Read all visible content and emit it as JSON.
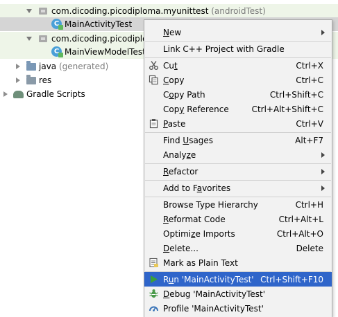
{
  "tree": {
    "rows": [
      {
        "label": "com.dicoding.picodiploma.myunittest",
        "suffix": "(androidTest)"
      },
      {
        "label": "MainActivityTest"
      },
      {
        "label": "com.dicoding.picodiplom"
      },
      {
        "label": "MainViewModelTest"
      },
      {
        "label": "java",
        "suffix": "(generated)"
      },
      {
        "label": "res"
      },
      {
        "label": "Gradle Scripts"
      }
    ]
  },
  "menu": {
    "items": [
      {
        "pre": "",
        "mn": "N",
        "post": "ew",
        "shortcut": ""
      },
      {
        "pre": "Link C++ Project with Gradle",
        "mn": "",
        "post": "",
        "shortcut": ""
      },
      {
        "pre": "Cu",
        "mn": "t",
        "post": "",
        "shortcut": "Ctrl+X"
      },
      {
        "pre": "",
        "mn": "C",
        "post": "opy",
        "shortcut": "Ctrl+C"
      },
      {
        "pre": "C",
        "mn": "o",
        "post": "py Path",
        "shortcut": "Ctrl+Shift+C"
      },
      {
        "pre": "Cop",
        "mn": "y",
        "post": " Reference",
        "shortcut": "Ctrl+Alt+Shift+C"
      },
      {
        "pre": "",
        "mn": "P",
        "post": "aste",
        "shortcut": "Ctrl+V"
      },
      {
        "pre": "Find ",
        "mn": "U",
        "post": "sages",
        "shortcut": "Alt+F7"
      },
      {
        "pre": "Analy",
        "mn": "z",
        "post": "e",
        "shortcut": ""
      },
      {
        "pre": "",
        "mn": "R",
        "post": "efactor",
        "shortcut": ""
      },
      {
        "pre": "Add to F",
        "mn": "a",
        "post": "vorites",
        "shortcut": ""
      },
      {
        "pre": "Browse Type Hierarchy",
        "mn": "",
        "post": "",
        "shortcut": "Ctrl+H"
      },
      {
        "pre": "",
        "mn": "R",
        "post": "eformat Code",
        "shortcut": "Ctrl+Alt+L"
      },
      {
        "pre": "Optimi",
        "mn": "z",
        "post": "e Imports",
        "shortcut": "Ctrl+Alt+O"
      },
      {
        "pre": "",
        "mn": "D",
        "post": "elete...",
        "shortcut": "Delete"
      },
      {
        "pre": "Mark as Plain Text",
        "mn": "",
        "post": "",
        "shortcut": ""
      },
      {
        "pre": "R",
        "mn": "u",
        "post": "n 'MainActivityTest'",
        "shortcut": "Ctrl+Shift+F10"
      },
      {
        "pre": "",
        "mn": "D",
        "post": "ebug 'MainActivityTest'",
        "shortcut": ""
      },
      {
        "pre": "Profile 'MainActivityTest'",
        "mn": "",
        "post": "",
        "shortcut": ""
      }
    ]
  },
  "icons": {
    "cut": "scissors-icon",
    "copy": "copy-icon",
    "paste": "clipboard-icon",
    "mark_plain_text": "plain-text-file-icon",
    "run": "play-icon",
    "debug": "bug-icon",
    "profile": "gauge-icon"
  },
  "colors": {
    "hover": "#2f65ca",
    "test_row": "#eef5e8",
    "selected_row": "#d5d5d5",
    "run_green": "#3aa03a"
  }
}
